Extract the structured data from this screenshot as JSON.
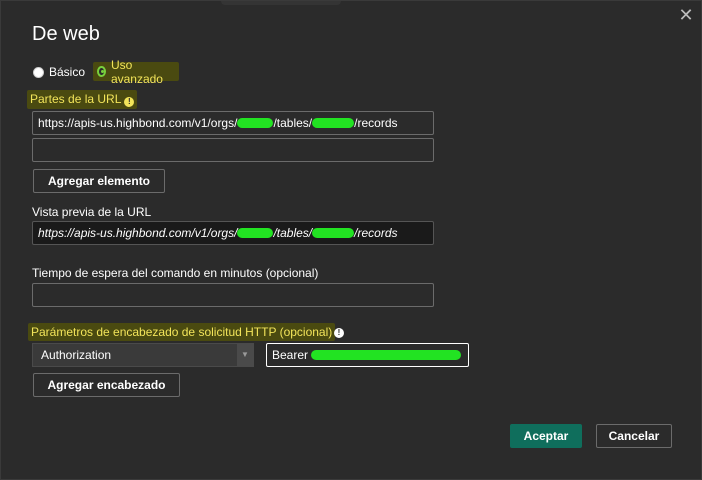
{
  "dialog": {
    "title": "De web",
    "close_glyph": "✕"
  },
  "mode": {
    "basic_label": "Básico",
    "advanced_label": "Uso avanzado",
    "selected": "advanced"
  },
  "url_parts": {
    "label": "Partes de la URL",
    "part1_prefix": "https://apis-us.highbond.com/v1/orgs/",
    "part1_middle": "/tables/",
    "part1_suffix": "/records",
    "part2_value": "",
    "add_button": "Agregar elemento"
  },
  "preview": {
    "label": "Vista previa de la URL",
    "prefix": "https://apis-us.highbond.com/v1/orgs/",
    "middle": "/tables/",
    "suffix": "/records"
  },
  "timeout": {
    "label": "Tiempo de espera del comando en minutos (opcional)",
    "value": ""
  },
  "headers": {
    "label": "Parámetros de encabezado de solicitud HTTP (opcional)",
    "key": "Authorization",
    "value_prefix": "Bearer ",
    "add_button": "Agregar encabezado"
  },
  "footer": {
    "ok": "Aceptar",
    "cancel": "Cancelar"
  },
  "colors": {
    "redaction": "#22e322",
    "highlight_text": "#f2e45a",
    "primary_button": "#0f6e5c"
  }
}
